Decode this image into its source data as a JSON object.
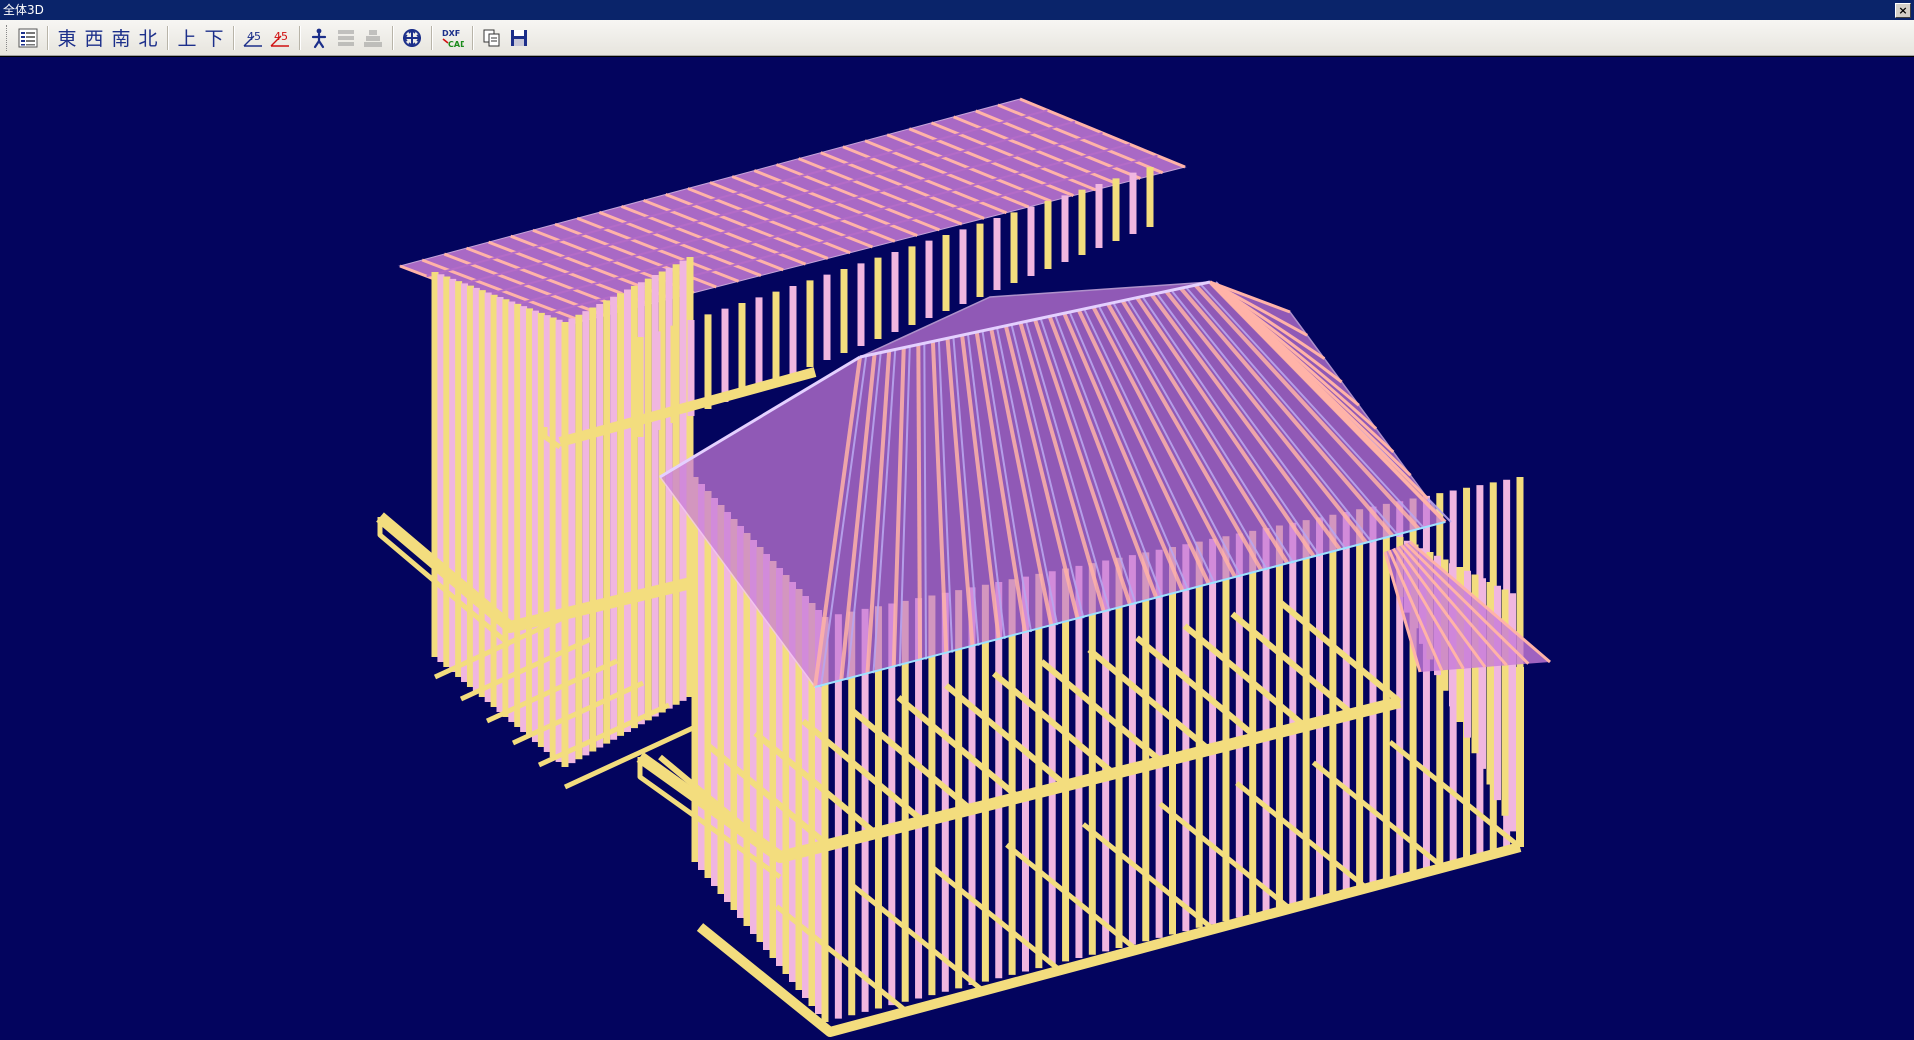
{
  "window": {
    "title": "全体3D",
    "close_glyph": "×"
  },
  "toolbar": {
    "view_directions": [
      "東",
      "西",
      "南",
      "北",
      "上",
      "下"
    ],
    "angle_buttons": [
      {
        "label": "45",
        "color": "#1c2f8a"
      },
      {
        "label": "45",
        "color": "#d01010"
      }
    ],
    "icons": [
      "settings-list-icon",
      "walk-person-icon",
      "layers-icon",
      "stack-icon",
      "fit-all-icon",
      "dxf-cad-export-icon",
      "copy-icon",
      "save-icon"
    ],
    "dxf_label_top": "DXF",
    "dxf_label_bottom": "CAD"
  },
  "scene": {
    "background": "#03045e",
    "frame_color": "#f3dd7e",
    "stud_color": "#f0b6e0",
    "roof_color": "#c77bd8",
    "rafter_color": "#ffb3a8"
  }
}
